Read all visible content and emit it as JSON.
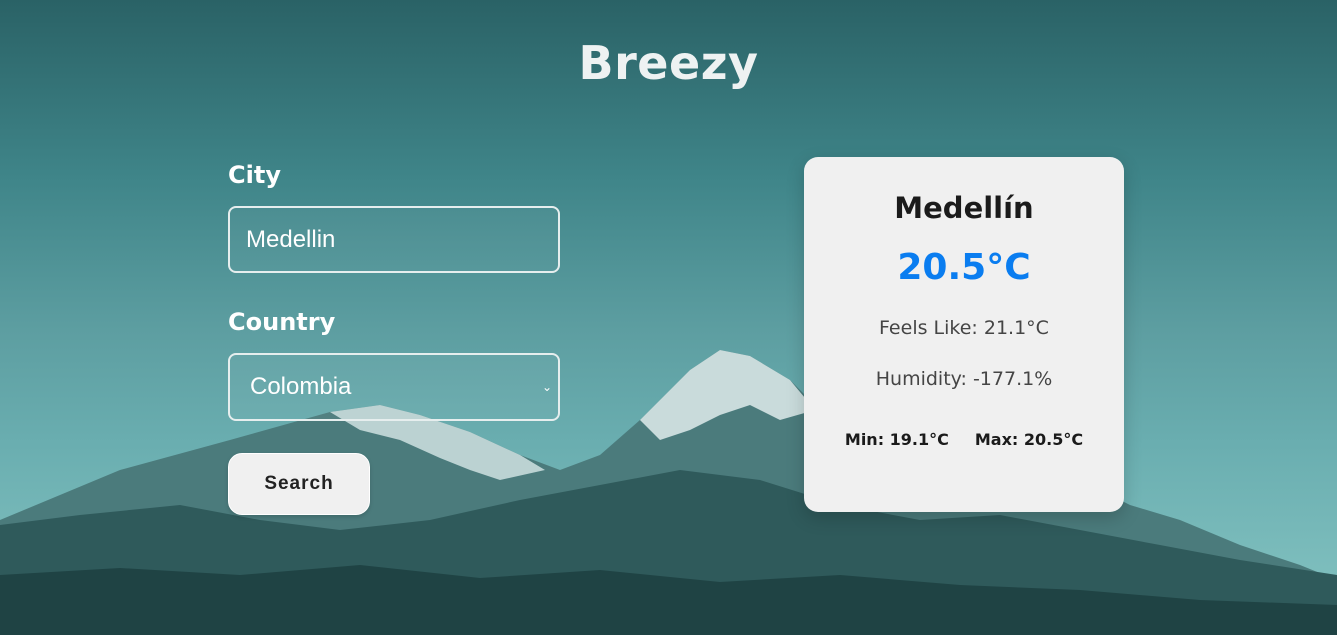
{
  "app": {
    "title": "Breezy"
  },
  "form": {
    "city_label": "City",
    "city_value": "Medellin",
    "country_label": "Country",
    "country_selected": "Colombia",
    "search_label": "Search"
  },
  "weather": {
    "city": "Medellín",
    "temperature": "20.5°C",
    "feels_like": "Feels Like: 21.1°C",
    "humidity": "Humidity: -177.1%",
    "min": "Min: 19.1°C",
    "max": "Max: 20.5°C"
  },
  "colors": {
    "accent_temp": "#0a7df0",
    "card_bg": "#f0f0f0"
  }
}
